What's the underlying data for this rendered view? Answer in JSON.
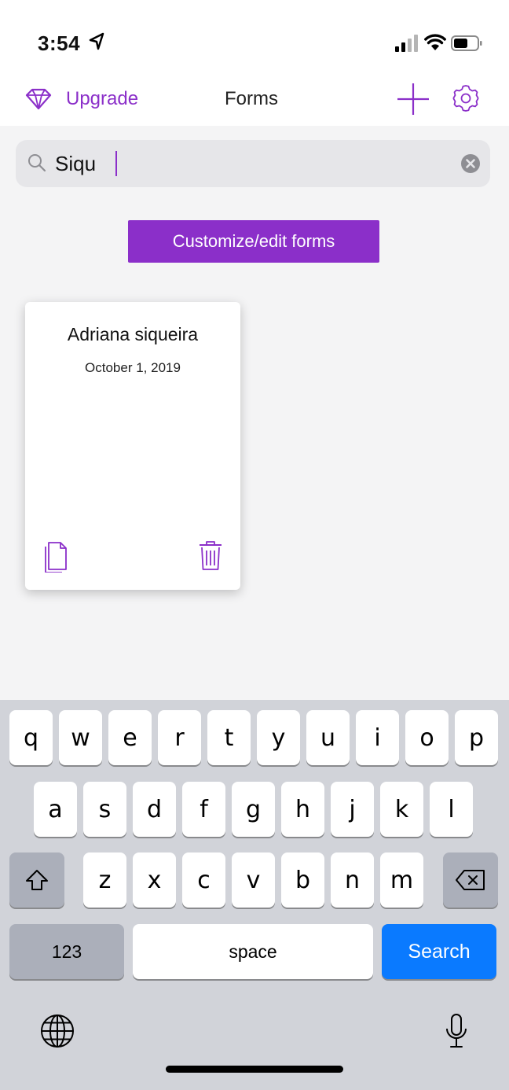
{
  "status_bar": {
    "time": "3:54",
    "icons": [
      "location-arrow-icon",
      "cellular-signal-icon",
      "wifi-icon",
      "battery-icon"
    ]
  },
  "nav": {
    "upgrade_label": "Upgrade",
    "upgrade_icon": "diamond-icon",
    "title": "Forms",
    "add_icon": "plus-icon",
    "settings_icon": "gear-icon"
  },
  "search": {
    "value": "Siqu",
    "placeholder": "",
    "search_icon": "magnifier-icon",
    "clear_icon": "clear-circle-icon"
  },
  "customize_button": "Customize/edit forms",
  "forms": [
    {
      "title": "Adriana siqueira",
      "date": "October 1, 2019",
      "copy_icon": "copy-document-icon",
      "delete_icon": "trash-icon"
    }
  ],
  "keyboard": {
    "row1": [
      "q",
      "w",
      "e",
      "r",
      "t",
      "y",
      "u",
      "i",
      "o",
      "p"
    ],
    "row2": [
      "a",
      "s",
      "d",
      "f",
      "g",
      "h",
      "j",
      "k",
      "l"
    ],
    "row3": [
      "z",
      "x",
      "c",
      "v",
      "b",
      "n",
      "m"
    ],
    "numbers_label": "123",
    "space_label": "space",
    "search_label": "Search",
    "shift_icon": "shift-arrow-icon",
    "backspace_icon": "backspace-icon",
    "globe_icon": "globe-icon",
    "mic_icon": "microphone-icon"
  },
  "colors": {
    "accent": "#8b2fc9",
    "keyboard_background": "#d1d3d9",
    "search_key": "#0a7aff",
    "content_background": "#f4f4f5"
  }
}
